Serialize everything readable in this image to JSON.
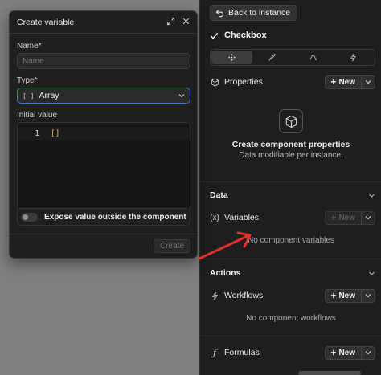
{
  "panel": {
    "back_label": "Back to instance",
    "component_name": "Checkbox",
    "tabs": [
      "move-icon",
      "brush-icon",
      "transform-icon",
      "lightning-icon"
    ],
    "properties": {
      "label": "Properties",
      "new_label": "New",
      "empty_title": "Create component properties",
      "empty_sub": "Data modifiable per instance."
    },
    "data": {
      "heading": "Data",
      "variables_label": "Variables",
      "variables_icon": "(x)",
      "new_label": "New",
      "empty": "No component variables"
    },
    "actions": {
      "heading": "Actions",
      "workflows_label": "Workflows",
      "new_label": "New",
      "empty": "No component workflows",
      "formulas_label": "Formulas",
      "formulas_icon": "ƒ",
      "formulas_new_label": "New"
    }
  },
  "dialog": {
    "title": "Create variable",
    "name_label": "Name",
    "required_mark": "*",
    "name_placeholder": "Name",
    "type_label": "Type",
    "type_icon": "[ ]",
    "type_value": "Array",
    "initial_label": "Initial value",
    "line_number": "1",
    "code_value": "[]",
    "expose_label": "Expose value outside the component",
    "create_label": "Create"
  },
  "colors": {
    "annotation_arrow": "#e0302a",
    "select_focus": "#3e78d6",
    "code": "#e8b53a"
  }
}
